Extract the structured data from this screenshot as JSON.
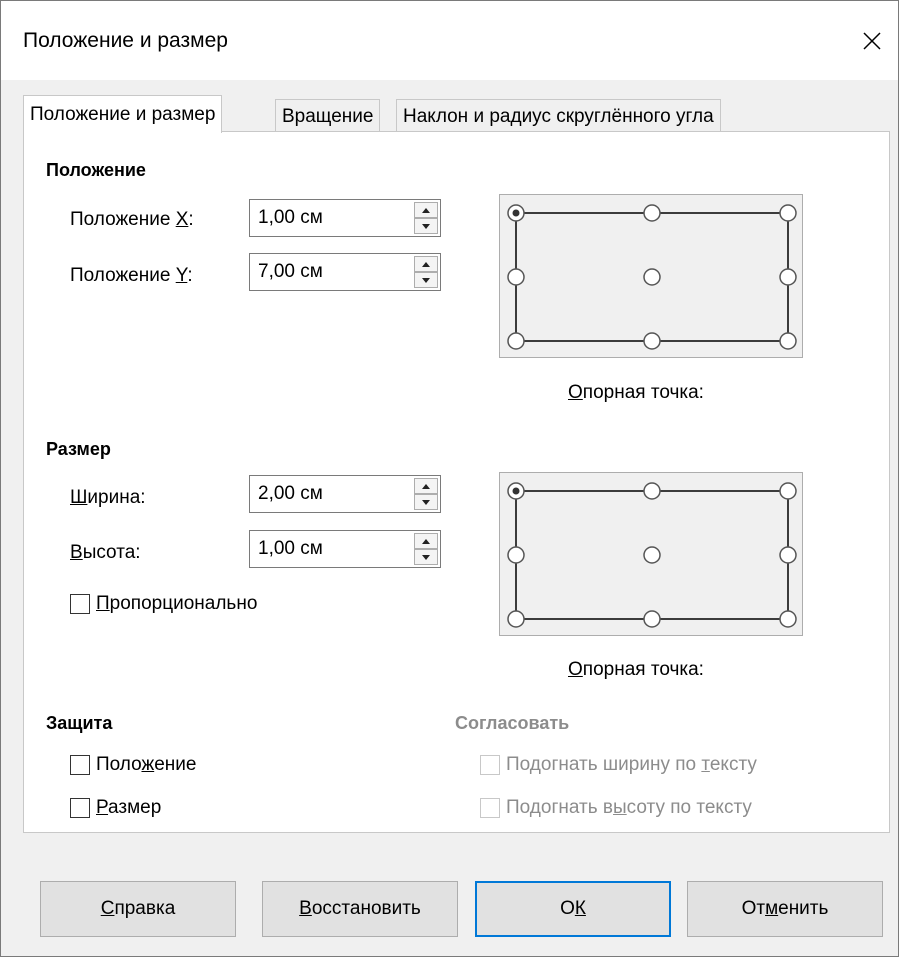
{
  "window": {
    "title": "Положение и размер"
  },
  "tabs": [
    {
      "label": "Положение и размер"
    },
    {
      "label": "Вращение"
    },
    {
      "label": "Наклон и радиус скруглённого угла"
    }
  ],
  "position": {
    "heading": "Положение",
    "x": {
      "label_pre": "Положение ",
      "label_key": "X",
      "label_post": ":",
      "value": "1,00 см"
    },
    "y": {
      "label_pre": "Положение ",
      "label_key": "Y",
      "label_post": ":",
      "value": "7,00 см"
    },
    "ref": {
      "label_key": "О",
      "label_rest": "порная точка:",
      "selected": "top-left"
    }
  },
  "size": {
    "heading": "Размер",
    "width": {
      "label_key": "Ш",
      "label_rest": "ирина:",
      "value": "2,00 см"
    },
    "height": {
      "label_key": "В",
      "label_rest": "ысота:",
      "value": "1,00 см"
    },
    "proportional": {
      "label_key": "П",
      "label_rest": "ропорционально",
      "checked": false
    },
    "ref": {
      "label_key": "О",
      "label_rest": "порная точка:",
      "selected": "top-left"
    }
  },
  "protect": {
    "heading": "Защита",
    "position": {
      "label_pre": "Поло",
      "label_key": "ж",
      "label_post": "ение",
      "checked": false
    },
    "size": {
      "label_key": "Р",
      "label_rest": "азмер",
      "checked": false
    }
  },
  "adapt": {
    "heading": "Согласовать",
    "fit_width": {
      "label_pre": "Подогнать ширину по ",
      "label_key": "т",
      "label_post": "ексту",
      "checked": false
    },
    "fit_height": {
      "label_pre": "Подогнать в",
      "label_key": "ы",
      "label_post": "соту по тексту",
      "checked": false
    }
  },
  "buttons": {
    "help": {
      "key": "С",
      "rest": "правка"
    },
    "reset": {
      "key": "В",
      "rest": "осстановить"
    },
    "ok": {
      "pre": "О",
      "key": "К"
    },
    "cancel": {
      "pre": "От",
      "key": "м",
      "post": "енить"
    }
  },
  "colors": {
    "accent": "#0078d7",
    "selected_radio": "#333333"
  }
}
